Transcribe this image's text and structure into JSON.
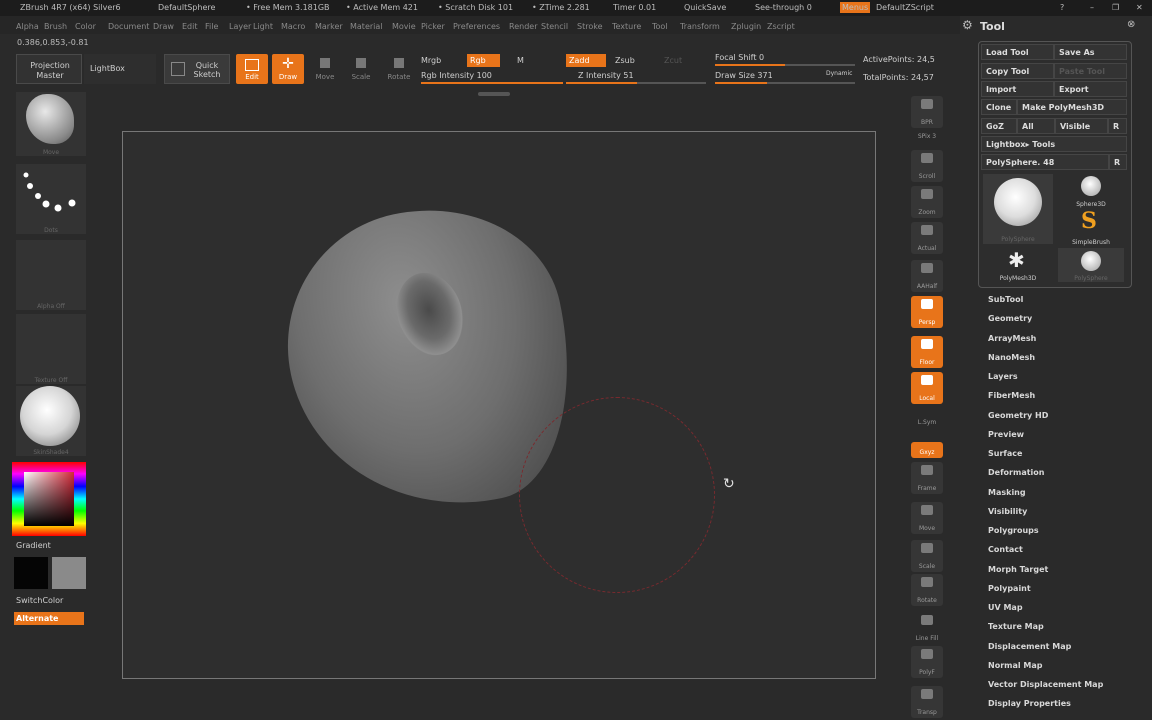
{
  "titlebar": {
    "app": "ZBrush 4R7 (x64) Silver6",
    "doc": "DefaultSphere",
    "free_mem": "• Free Mem 3.181GB",
    "active_mem": "• Active Mem 421",
    "scratch": "• Scratch Disk 101",
    "ztime": "• ZTime 2.281",
    "timer": "Timer 0.01",
    "quicksave": "QuickSave",
    "see_through": "See-through  0",
    "menus": "Menus",
    "script": "DefaultZScript"
  },
  "menubar": [
    "Alpha",
    "Brush",
    "Color",
    "Document",
    "Draw",
    "Edit",
    "File",
    "Layer",
    "Light",
    "Macro",
    "Marker",
    "Material",
    "Movie",
    "Picker",
    "Preferences",
    "Render",
    "Stencil",
    "Stroke",
    "Texture",
    "Tool",
    "Transform",
    "Zplugin",
    "Zscript"
  ],
  "coords": "0.386,0.853,-0.81",
  "toolbar": {
    "projection_master": "Projection Master",
    "lightbox": "LightBox",
    "quick_sketch": "Quick Sketch",
    "edit": "Edit",
    "draw": "Draw",
    "move": "Move",
    "scale": "Scale",
    "rotate": "Rotate",
    "mrgb": "Mrgb",
    "rgb": "Rgb",
    "m": "M",
    "rgb_intensity": "Rgb Intensity 100",
    "zadd": "Zadd",
    "zsub": "Zsub",
    "zcut": "Zcut",
    "z_intensity": "Z Intensity 51",
    "focal_shift": "Focal Shift 0",
    "draw_size": "Draw Size 371",
    "dynamic": "Dynamic",
    "active_points": "ActivePoints: 24,5",
    "total_points": "TotalPoints: 24,57"
  },
  "sliders": {
    "rgb_intensity": 1.0,
    "z_intensity": 0.51,
    "focal_shift": 0.5,
    "draw_size": 0.37
  },
  "left_shelf": {
    "brush_label": "Move",
    "stroke_label": "Dots",
    "alpha_label": "Alpha Off",
    "texture_label": "Texture Off",
    "material_label": "SkinShade4",
    "gradient": "Gradient",
    "switch_color": "SwitchColor",
    "alternate": "Alternate"
  },
  "right_shelf": [
    {
      "name": "bpr",
      "label": "BPR",
      "active": false
    },
    {
      "name": "spix",
      "label": "SPix 3",
      "active": false
    },
    {
      "name": "scroll",
      "label": "Scroll",
      "active": false
    },
    {
      "name": "zoom",
      "label": "Zoom",
      "active": false
    },
    {
      "name": "actual",
      "label": "Actual",
      "active": false
    },
    {
      "name": "aahalf",
      "label": "AAHalf",
      "active": false
    },
    {
      "name": "persp",
      "label": "Persp",
      "active": true
    },
    {
      "name": "floor",
      "label": "Floor",
      "active": true
    },
    {
      "name": "local",
      "label": "Local",
      "active": true
    },
    {
      "name": "lsym",
      "label": "L.Sym",
      "active": false
    },
    {
      "name": "xyz",
      "label": "Gxyz",
      "active": true
    },
    {
      "name": "frame",
      "label": "Frame",
      "active": false
    },
    {
      "name": "move",
      "label": "Move",
      "active": false
    },
    {
      "name": "scale",
      "label": "Scale",
      "active": false
    },
    {
      "name": "rotate",
      "label": "Rotate",
      "active": false
    },
    {
      "name": "linefill",
      "label": "Line Fill",
      "active": false
    },
    {
      "name": "polyf",
      "label": "PolyF",
      "active": false
    },
    {
      "name": "transp",
      "label": "Transp",
      "active": false
    }
  ],
  "tool_panel": {
    "title": "Tool",
    "load_tool": "Load Tool",
    "save_as": "Save As",
    "copy_tool": "Copy Tool",
    "paste_tool": "Paste Tool",
    "import": "Import",
    "export": "Export",
    "clone": "Clone",
    "make_polymesh": "Make PolyMesh3D",
    "goz": "GoZ",
    "all": "All",
    "visible": "Visible",
    "r": "R",
    "lightbox_tools": "Lightbox▸ Tools",
    "current_tool": "PolySphere. 48",
    "thumbs": [
      "PolySphere",
      "Sphere3D",
      "SimpleBrush",
      "PolyMesh3D",
      "PolySphere"
    ],
    "sections": [
      "SubTool",
      "Geometry",
      "ArrayMesh",
      "NanoMesh",
      "Layers",
      "FiberMesh",
      "Geometry HD",
      "Preview",
      "Surface",
      "Deformation",
      "Masking",
      "Visibility",
      "Polygroups",
      "Contact",
      "Morph Target",
      "Polypaint",
      "UV Map",
      "Texture Map",
      "Displacement Map",
      "Normal Map",
      "Vector Displacement Map",
      "Display Properties"
    ]
  },
  "colors": {
    "accent": "#e8741a",
    "bg": "#2a2a2a",
    "canvas": "#2e2e2e"
  }
}
